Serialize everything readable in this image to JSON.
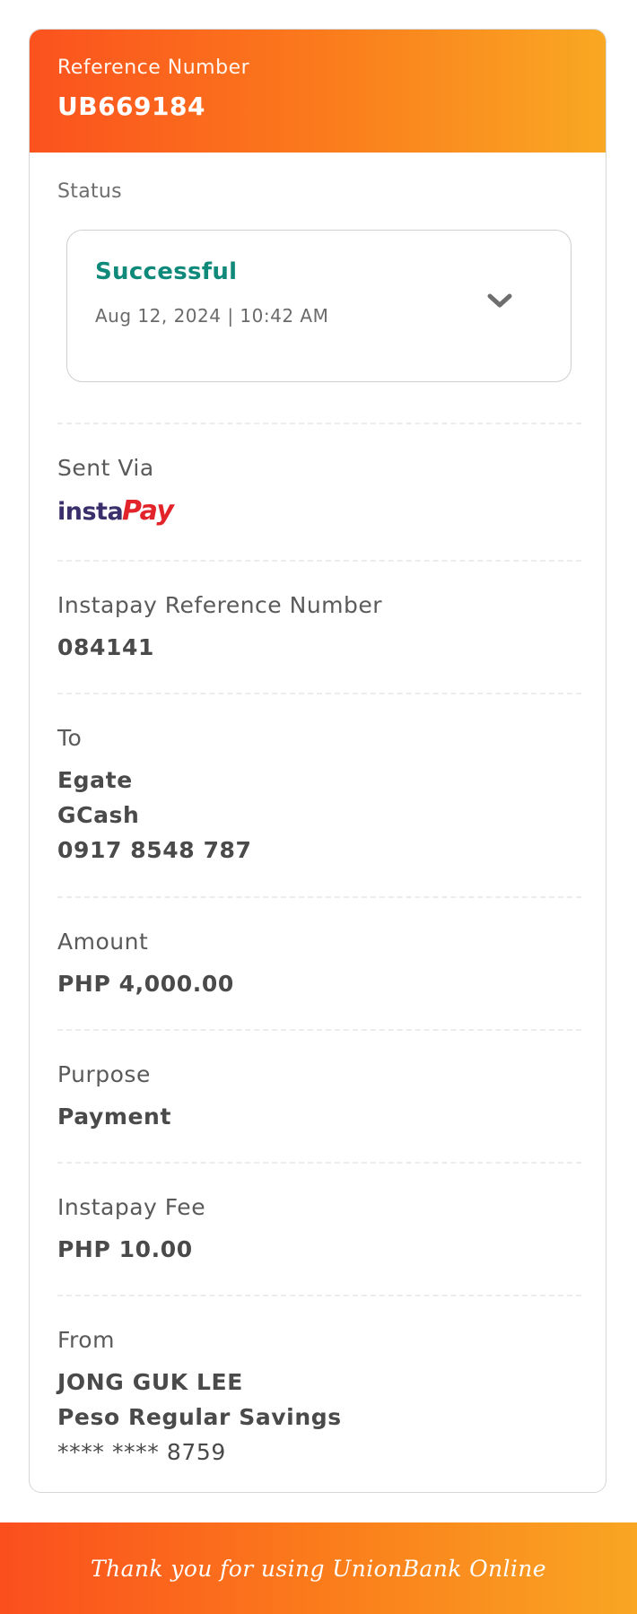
{
  "header": {
    "ref_label": "Reference Number",
    "ref_value": "UB669184"
  },
  "status": {
    "label": "Status",
    "value": "Successful",
    "datetime": "Aug 12, 2024 | 10:42 AM",
    "status_color": "#0f8a7a",
    "expand_icon": "chevron-down-icon"
  },
  "sent_via": {
    "label": "Sent Via",
    "logo_text_left": "insta",
    "logo_text_right": "Pay"
  },
  "instapay_ref": {
    "label": "Instapay Reference Number",
    "value": "084141"
  },
  "to": {
    "label": "To",
    "name": "Egate",
    "bank": "GCash",
    "account": "0917 8548 787"
  },
  "amount": {
    "label": "Amount",
    "value": "PHP 4,000.00"
  },
  "purpose": {
    "label": "Purpose",
    "value": "Payment"
  },
  "fee": {
    "label": "Instapay Fee",
    "value": "PHP 10.00"
  },
  "from": {
    "label": "From",
    "name": "JONG GUK  LEE",
    "account_type": "Peso Regular Savings",
    "account": "**** **** 8759"
  },
  "footer": {
    "text": "Thank you for using UnionBank Online"
  },
  "colors": {
    "brand_orange": "#fb521e",
    "brand_yellow": "#f9a823",
    "success_green": "#0f8a7a"
  }
}
